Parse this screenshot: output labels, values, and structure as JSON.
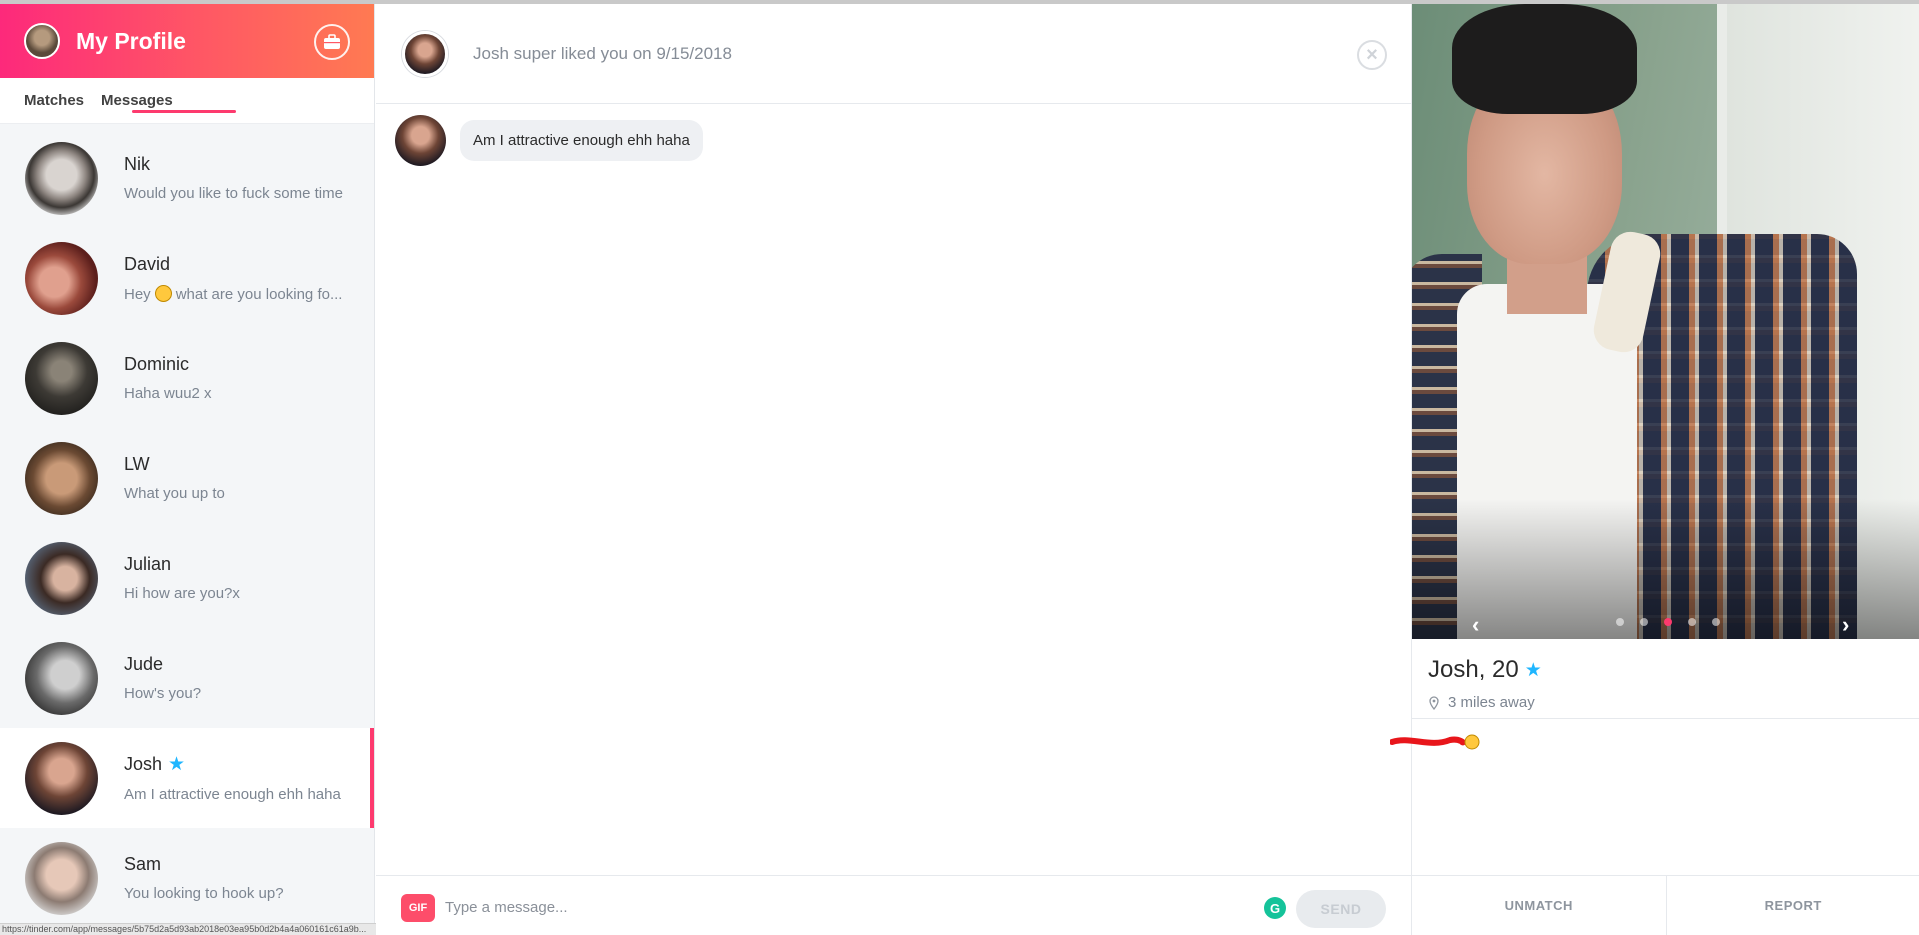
{
  "sidebar": {
    "title": "My Profile",
    "tabs": [
      {
        "label": "Matches"
      },
      {
        "label": "Messages"
      }
    ],
    "conversations": [
      {
        "name": "Nik",
        "message": "Would you like to fuck some time"
      },
      {
        "name": "David",
        "message_pre": "Hey",
        "message_post": "what are you looking fo..."
      },
      {
        "name": "Dominic",
        "message": "Haha wuu2 x"
      },
      {
        "name": "LW",
        "message": "What you up to"
      },
      {
        "name": "Julian",
        "message": "Hi how are you?x"
      },
      {
        "name": "Jude",
        "message": "How's you?"
      },
      {
        "name": "Josh",
        "message": "Am I attractive enough ehh haha"
      },
      {
        "name": "Sam",
        "message": "You looking to hook up?"
      }
    ],
    "status_url": "https://tinder.com/app/messages/5b75d2a5d93ab2018e03ea95b0d2b4a4a060161c61a9b..."
  },
  "chat": {
    "header": "Josh super liked you on 9/15/2018",
    "messages": [
      {
        "text": "Am I attractive enough ehh haha"
      }
    ],
    "composer": {
      "gif_label": "GIF",
      "placeholder": "Type a message...",
      "send_label": "SEND"
    }
  },
  "profile": {
    "name_age": "Josh, 20",
    "distance": "3 miles away",
    "photo_count": 5,
    "active_photo": 3,
    "unmatch_label": "UNMATCH",
    "report_label": "REPORT"
  },
  "colors": {
    "brand_start": "#fd297b",
    "brand_end": "#ff7a52",
    "accent": "#fd3a6e",
    "superlike_star": "#1fb6ff"
  }
}
